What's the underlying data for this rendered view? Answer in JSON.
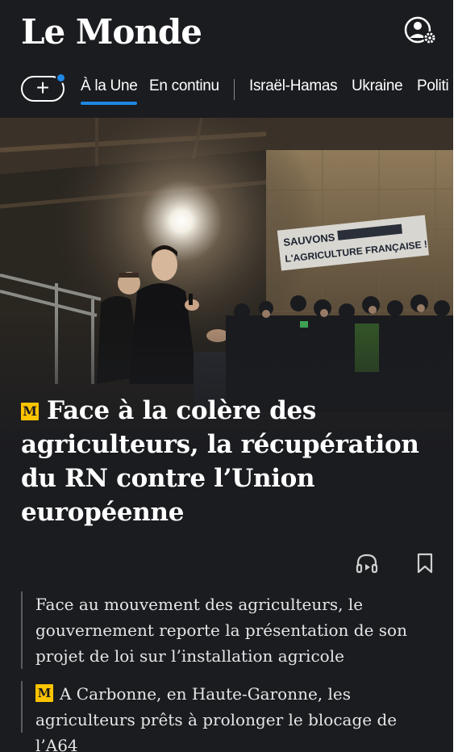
{
  "header": {
    "logo": "Le Monde",
    "account_icon": "account-settings-icon"
  },
  "nav": {
    "add_icon": "plus-icon",
    "tabs": [
      {
        "label": "À la Une",
        "active": true
      },
      {
        "label": "En continu",
        "active": false
      },
      {
        "label": "Israël-Hamas",
        "active": false
      },
      {
        "label": "Ukraine",
        "active": false
      },
      {
        "label": "Politi",
        "active": false
      }
    ],
    "accent": "#1f88e5"
  },
  "hero": {
    "banner_line1": "SAUVONS",
    "banner_line2": "L'AGRICULTURE FRANÇAISE !"
  },
  "article": {
    "badge": "M",
    "headline": "Face à la colère des agriculteurs, la récupération du RN contre l’Union européenne",
    "badge_color": "#ffc400"
  },
  "actions": {
    "audio_icon": "headphones-icon",
    "bookmark_icon": "bookmark-icon"
  },
  "related": [
    {
      "text": "Face au mouvement des agriculteurs, le gouvernement reporte la présentation de son projet de loi sur l’installation agricole",
      "premium": false
    },
    {
      "text": "A Carbonne, en Haute-Garonne, les agriculteurs prêts à prolonger le blocage de l’A64",
      "premium": true,
      "badge": "M"
    }
  ]
}
